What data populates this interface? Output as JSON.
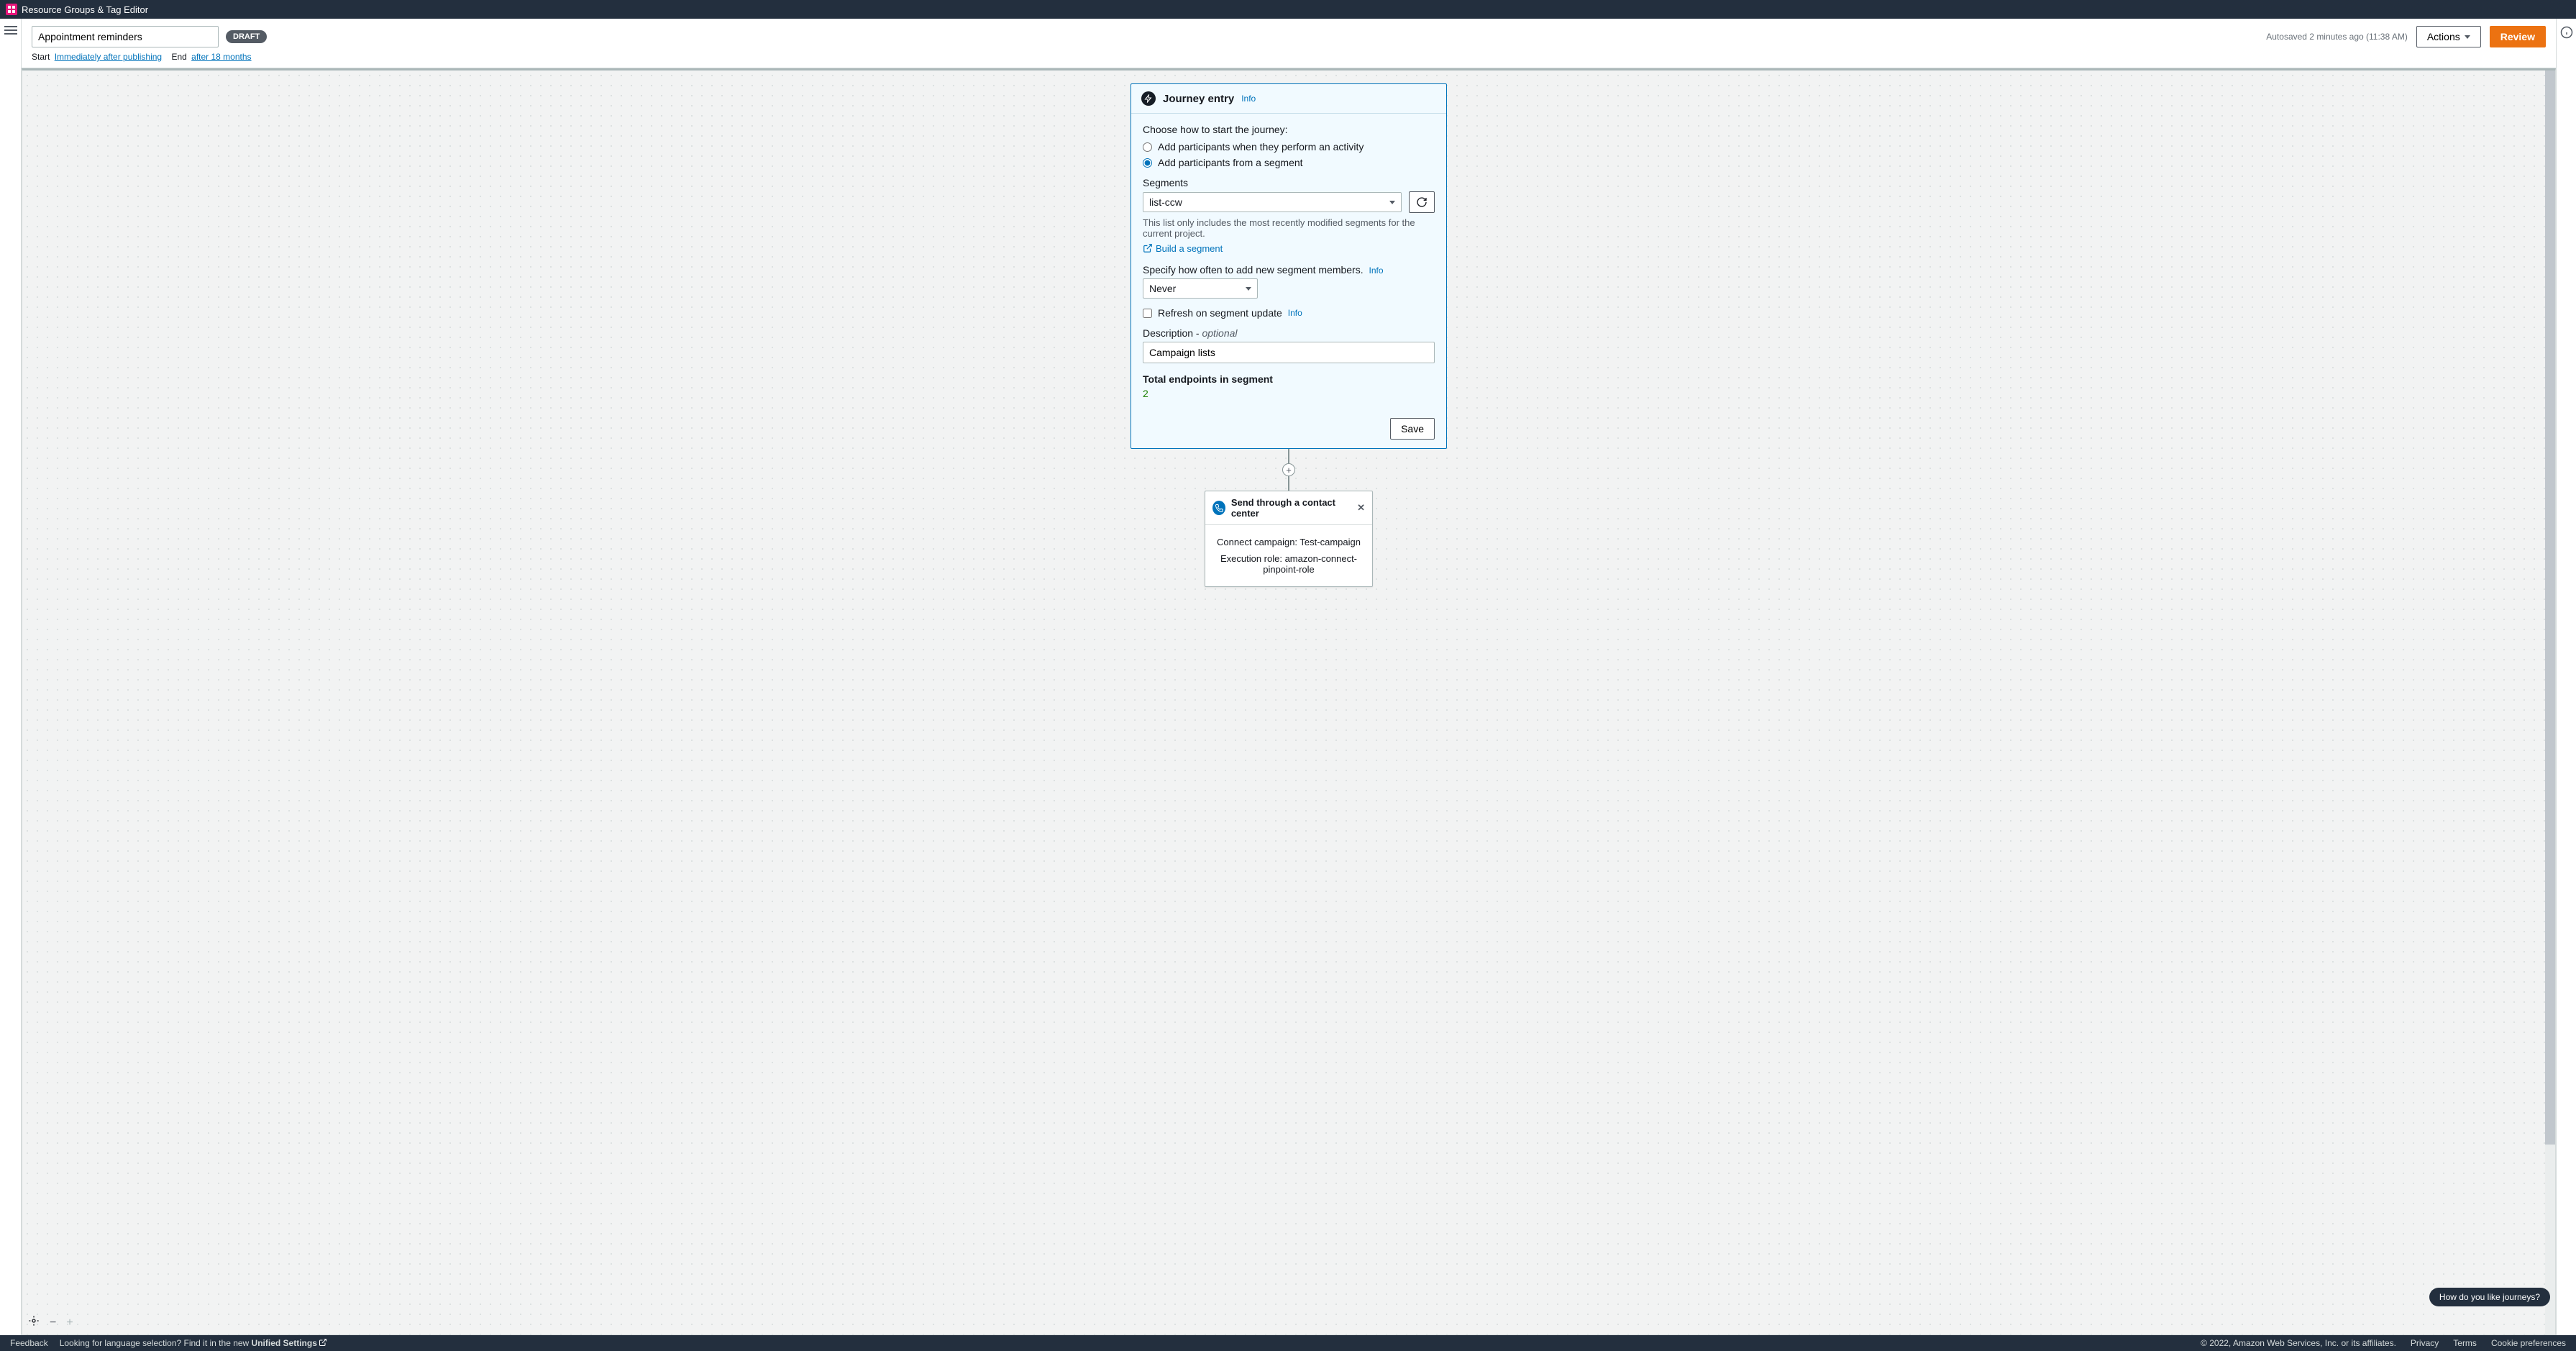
{
  "topbar": {
    "service": "Resource Groups & Tag Editor"
  },
  "header": {
    "journey_name": "Appointment reminders",
    "status_badge": "DRAFT",
    "autosave": "Autosaved 2 minutes ago (11:38 AM)",
    "actions_label": "Actions",
    "review_label": "Review",
    "start_label": "Start",
    "start_val": "Immediately after publishing",
    "end_label": "End",
    "end_val": "after 18 months"
  },
  "entry": {
    "title": "Journey entry",
    "info": "Info",
    "choose_label": "Choose how to start the journey:",
    "opt_activity": "Add participants when they perform an activity",
    "opt_segment": "Add participants from a segment",
    "segments_label": "Segments",
    "segment_selected": "list-ccw",
    "segments_help": "This list only includes the most recently modified segments for the current project.",
    "build_segment": "Build a segment",
    "frequency_label": "Specify how often to add new segment members.",
    "frequency_info": "Info",
    "frequency_selected": "Never",
    "refresh_check": "Refresh on segment update",
    "refresh_info": "Info",
    "description_label": "Description - ",
    "description_optional": "optional",
    "description_value": "Campaign lists",
    "endpoints_label": "Total endpoints in segment",
    "endpoints_value": "2",
    "save": "Save"
  },
  "cc": {
    "title": "Send through a contact center",
    "line1": "Connect campaign: Test-campaign",
    "line2": "Execution role: amazon-connect-pinpoint-role"
  },
  "feedback_prompt": "How do you like journeys?",
  "footer": {
    "feedback": "Feedback",
    "lang_hint": "Looking for language selection? Find it in the new ",
    "unified": "Unified Settings",
    "copyright": "© 2022, Amazon Web Services, Inc. or its affiliates.",
    "privacy": "Privacy",
    "terms": "Terms",
    "cookies": "Cookie preferences"
  }
}
